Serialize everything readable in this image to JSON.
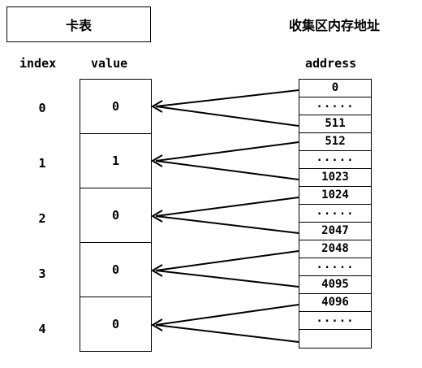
{
  "header": {
    "card_table_title": "卡表",
    "address_title": "收集区内存地址"
  },
  "columns": {
    "index": "index",
    "value": "value",
    "address": "address"
  },
  "cards": [
    {
      "index": "0",
      "value": "0"
    },
    {
      "index": "1",
      "value": "1"
    },
    {
      "index": "2",
      "value": "0"
    },
    {
      "index": "3",
      "value": "0"
    },
    {
      "index": "4",
      "value": "0"
    }
  ],
  "addresses": [
    "0",
    ".....",
    "511",
    "512",
    ".....",
    "1023",
    "1024",
    ".....",
    "2047",
    "2048",
    ".....",
    "4095",
    "4096",
    ".....",
    ""
  ]
}
